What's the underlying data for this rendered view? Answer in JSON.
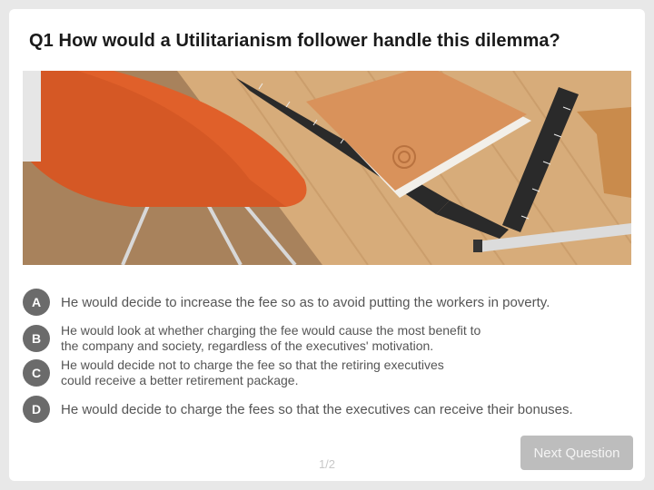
{
  "question": {
    "title": "Q1 How would a Utilitarianism follower handle this dilemma?"
  },
  "image": {
    "icon": "desk-photo"
  },
  "answers": [
    {
      "letter": "A",
      "text": "He would decide to increase the fee so as to avoid putting the workers in poverty."
    },
    {
      "letter": "B",
      "text": "He would look at whether charging the fee would cause the most benefit to\nthe company and society, regardless of the executives' motivation."
    },
    {
      "letter": "C",
      "text": "He would decide not to charge the fee so that the retiring executives\ncould receive a better retirement package."
    },
    {
      "letter": "D",
      "text": "He would decide to charge the fees so that the executives can receive their bonuses."
    }
  ],
  "footer": {
    "page_indicator": "1/2",
    "next_label": "Next Question"
  },
  "colors": {
    "badge": "#6b6b6b",
    "button_disabled": "#bdbdbd",
    "background": "#e8e8e8"
  }
}
